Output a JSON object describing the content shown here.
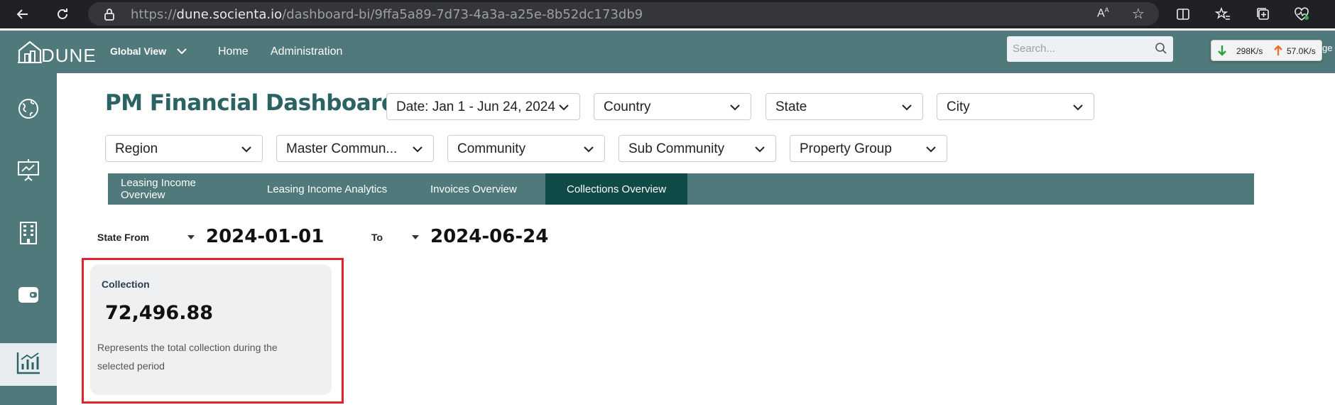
{
  "browser": {
    "url_prefix": "https://",
    "url_host": "dune.socienta.io",
    "url_path": "/dashboard-bi/9ffa5a89-7d73-4a3a-a25e-8b52dc173db9"
  },
  "header": {
    "logo_text": "DUNE",
    "global_view": "Global View",
    "nav": [
      "Home",
      "Administration"
    ],
    "search_placeholder": "Search...",
    "download_speed": "298K/s",
    "upload_speed": "57.0K/s",
    "cut_text": "ge"
  },
  "page": {
    "title": "PM Financial Dashboard"
  },
  "filters": {
    "row1": [
      "Date: Jan 1 - Jun 24, 2024",
      "Country",
      "State",
      "City"
    ],
    "row2": [
      "Region",
      "Master Commun...",
      "Community",
      "Sub Community",
      "Property Group"
    ]
  },
  "tabs": {
    "items": [
      "Leasing Income Overview",
      "Leasing Income Analytics",
      "Invoices Overview",
      "Collections Overview"
    ],
    "active": "Collections Overview"
  },
  "date_range": {
    "from_label": "State From",
    "from_value": "2024-01-01",
    "to_label": "To",
    "to_value": "2024-06-24"
  },
  "card": {
    "title": "Collection",
    "value": "72,496.88",
    "description": "Represents the total collection during the selected period"
  },
  "colors": {
    "brand": "#50797b",
    "tab_active": "#0f4a47",
    "title": "#2b6364",
    "highlight": "#e2242a"
  }
}
